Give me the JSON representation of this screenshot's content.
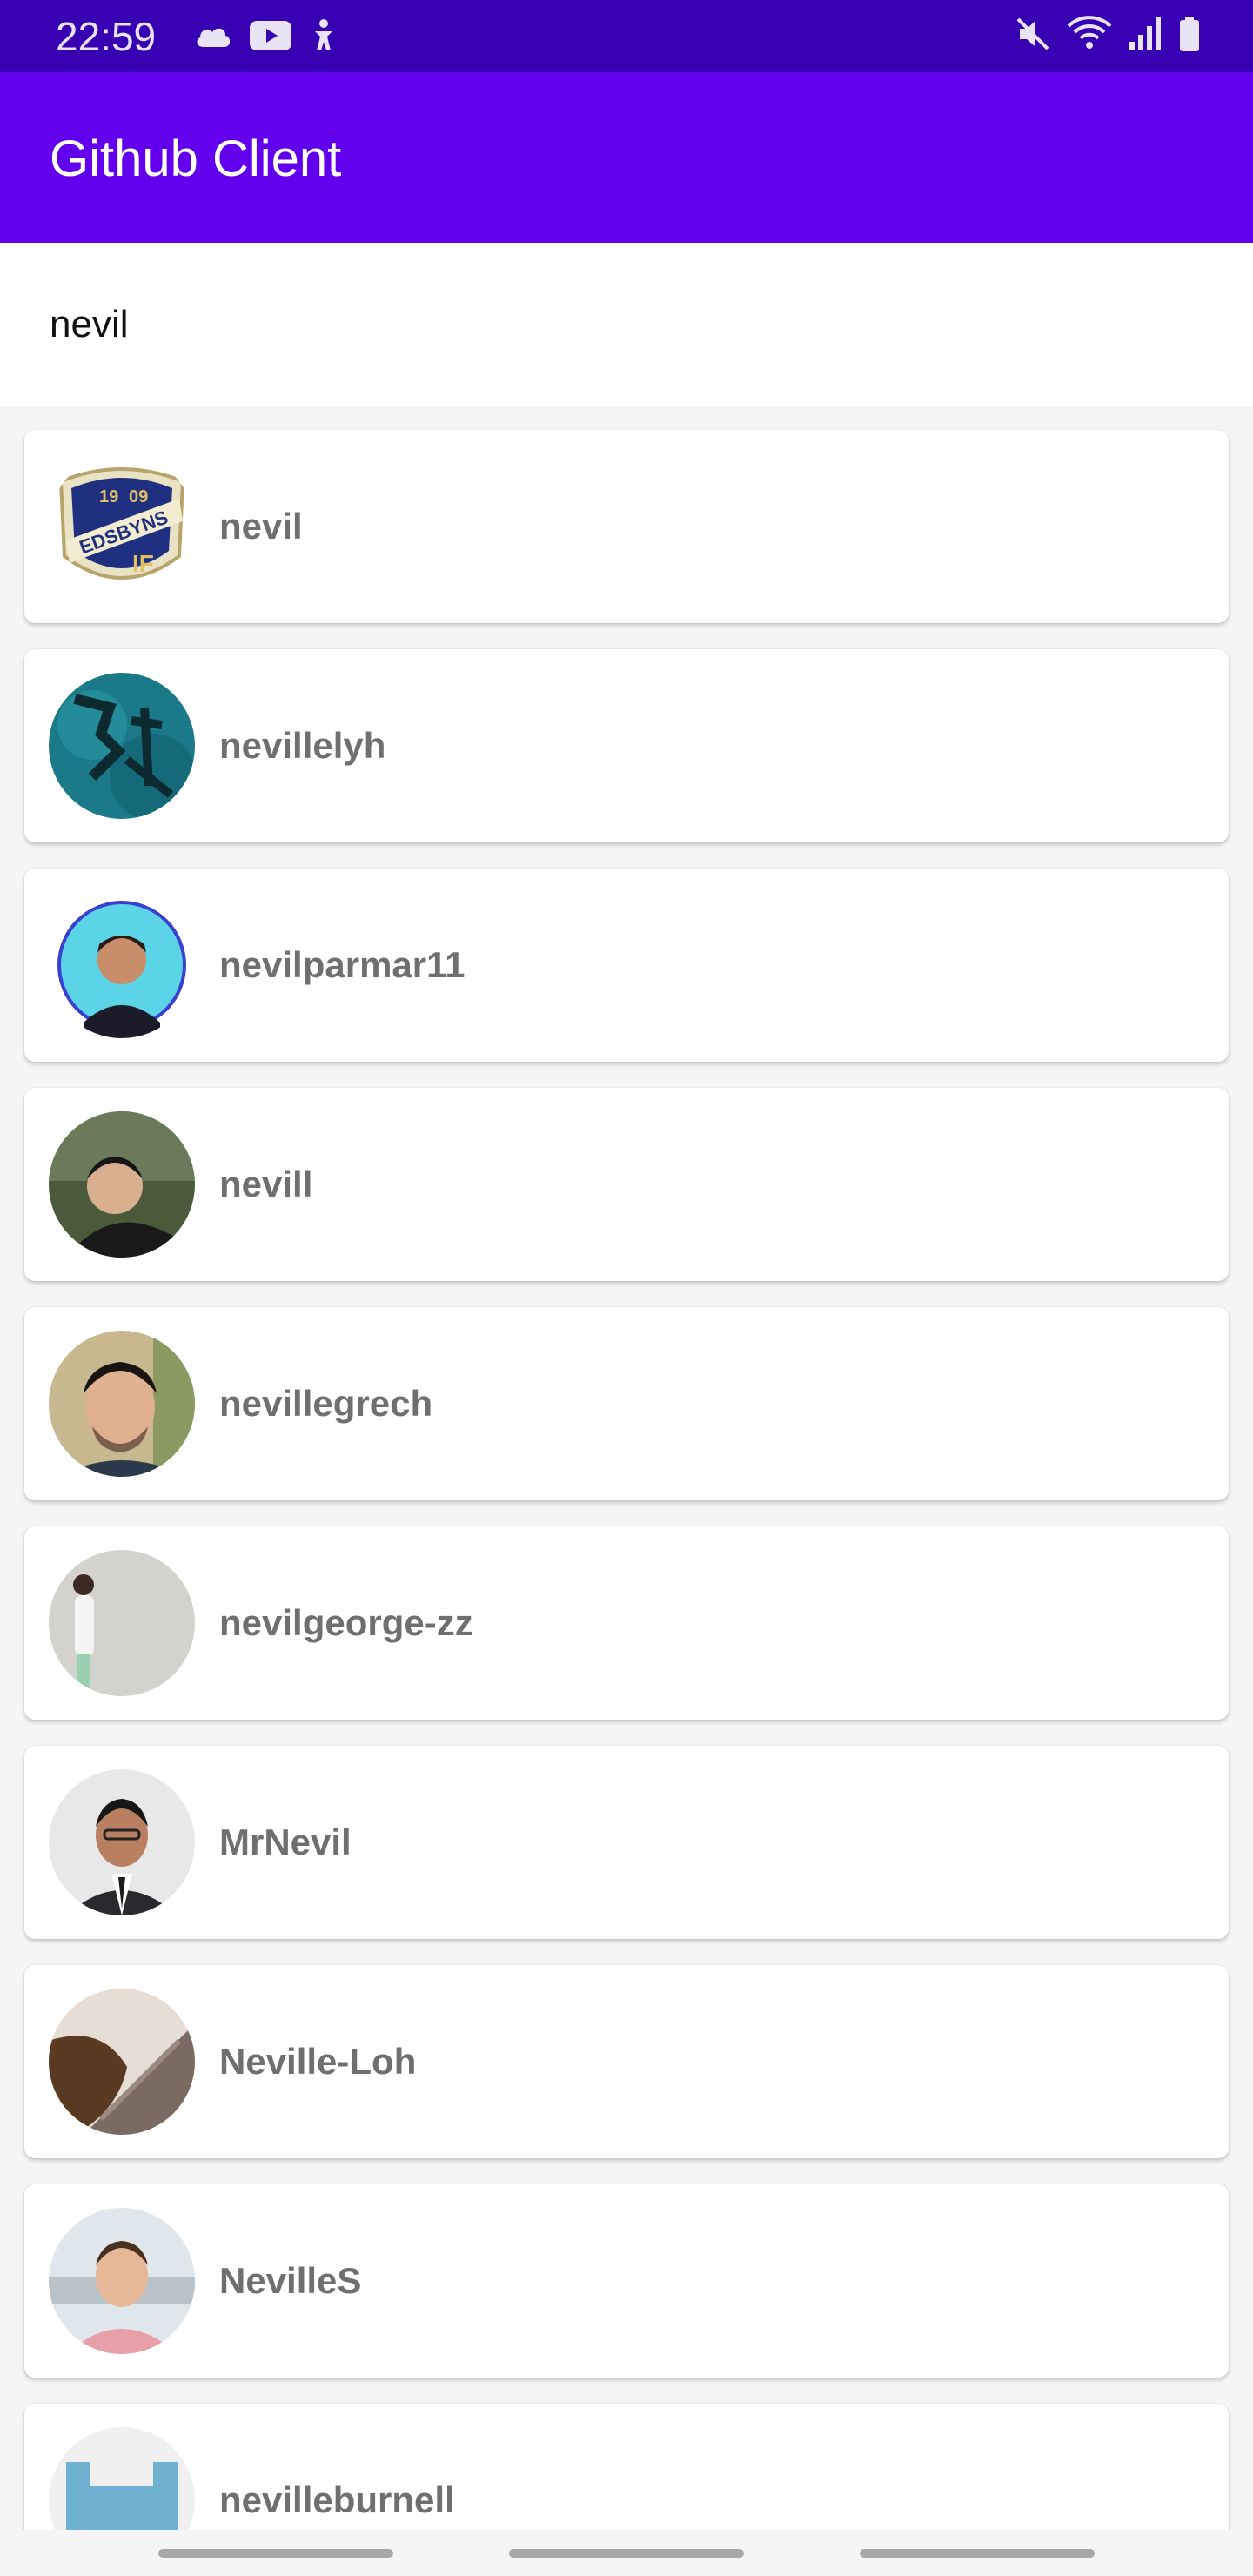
{
  "status_bar": {
    "time": "22:59",
    "left_icons": [
      "cloud-icon",
      "youtube-icon",
      "accessibility-icon"
    ],
    "right_icons": [
      "mute-icon",
      "wifi-icon",
      "signal-icon",
      "battery-icon"
    ]
  },
  "app_bar": {
    "title": "Github Client",
    "color": "#6200EE"
  },
  "search": {
    "value": "nevil"
  },
  "users": [
    {
      "login": "nevil"
    },
    {
      "login": "nevillelyh"
    },
    {
      "login": "nevilparmar11"
    },
    {
      "login": "nevill"
    },
    {
      "login": "nevillegrech"
    },
    {
      "login": "nevilgeorge-zz"
    },
    {
      "login": "MrNevil"
    },
    {
      "login": "Neville-Loh"
    },
    {
      "login": "NevilleS"
    },
    {
      "login": "nevilleburnell"
    }
  ]
}
